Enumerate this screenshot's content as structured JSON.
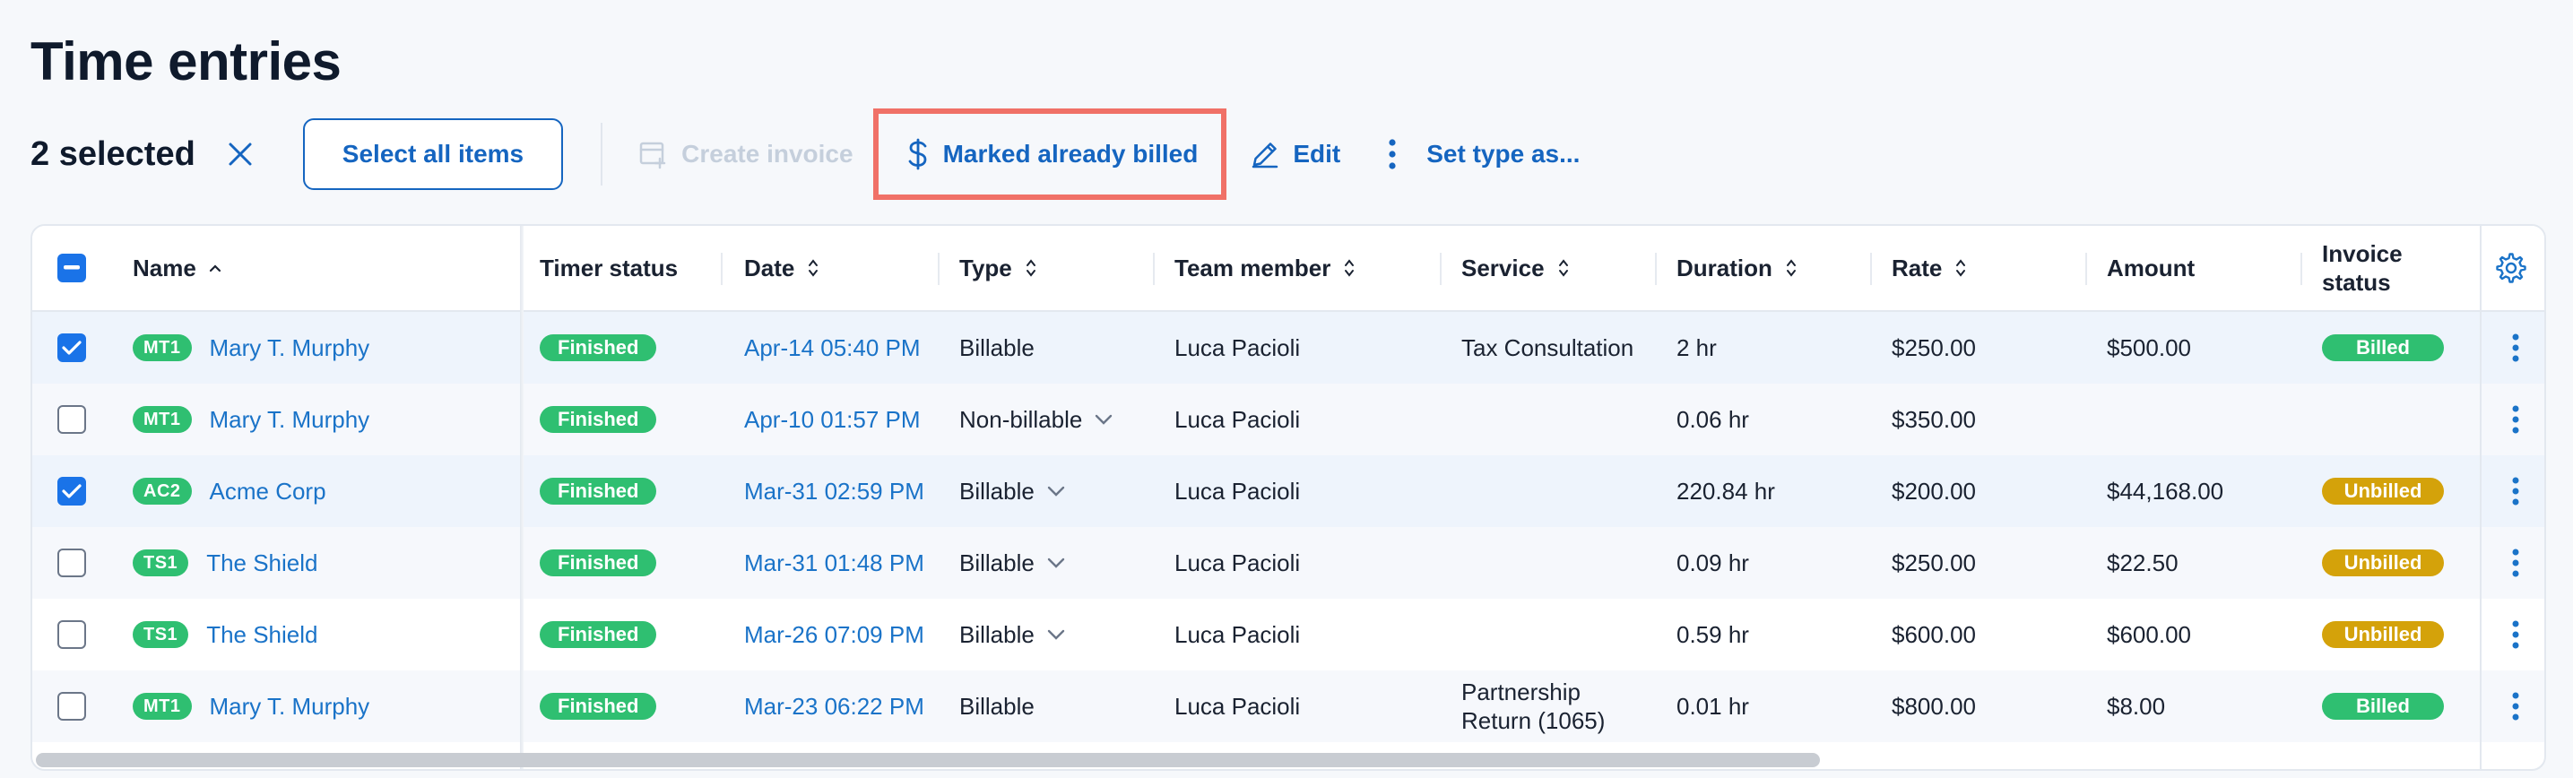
{
  "page": {
    "title": "Time entries"
  },
  "toolbar": {
    "selected_count": "2 selected",
    "select_all": "Select all items",
    "create_invoice": "Create invoice",
    "mark_billed": "Marked already billed",
    "edit": "Edit",
    "set_type": "Set type as..."
  },
  "table": {
    "headers": {
      "name": "Name",
      "timer_status": "Timer status",
      "date": "Date",
      "type": "Type",
      "team_member": "Team member",
      "service": "Service",
      "duration": "Duration",
      "rate": "Rate",
      "amount": "Amount",
      "invoice_status_1": "Invoice",
      "invoice_status_2": "status"
    },
    "rows": [
      {
        "checked": true,
        "badge": "MT1",
        "name": "Mary T. Murphy",
        "timer": "Finished",
        "date": "Apr-14 05:40 PM",
        "type": "Billable",
        "member": "Luca Pacioli",
        "service_1": "Tax Consultation",
        "service_2": "",
        "duration": "2 hr",
        "rate": "$250.00",
        "amount": "$500.00",
        "invoice": "Billed"
      },
      {
        "checked": false,
        "badge": "MT1",
        "name": "Mary T. Murphy",
        "timer": "Finished",
        "date": "Apr-10 01:57 PM",
        "type": "Non-billable",
        "member": "Luca Pacioli",
        "service_1": "",
        "service_2": "",
        "duration": "0.06 hr",
        "rate": "$350.00",
        "amount": "",
        "invoice": ""
      },
      {
        "checked": true,
        "badge": "AC2",
        "name": "Acme Corp",
        "timer": "Finished",
        "date": "Mar-31 02:59 PM",
        "type": "Billable",
        "member": "Luca Pacioli",
        "service_1": "",
        "service_2": "",
        "duration": "220.84 hr",
        "rate": "$200.00",
        "amount": "$44,168.00",
        "invoice": "Unbilled"
      },
      {
        "checked": false,
        "badge": "TS1",
        "name": "The Shield",
        "timer": "Finished",
        "date": "Mar-31 01:48 PM",
        "type": "Billable",
        "member": "Luca Pacioli",
        "service_1": "",
        "service_2": "",
        "duration": "0.09 hr",
        "rate": "$250.00",
        "amount": "$22.50",
        "invoice": "Unbilled"
      },
      {
        "checked": false,
        "badge": "TS1",
        "name": "The Shield",
        "timer": "Finished",
        "date": "Mar-26 07:09 PM",
        "type": "Billable",
        "member": "Luca Pacioli",
        "service_1": "",
        "service_2": "",
        "duration": "0.59 hr",
        "rate": "$600.00",
        "amount": "$600.00",
        "invoice": "Unbilled"
      },
      {
        "checked": false,
        "badge": "MT1",
        "name": "Mary T. Murphy",
        "timer": "Finished",
        "date": "Mar-23 06:22 PM",
        "type": "Billable",
        "member": "Luca Pacioli",
        "service_1": "Partnership",
        "service_2": "Return (1065)",
        "duration": "0.01 hr",
        "rate": "$800.00",
        "amount": "$8.00",
        "invoice": "Billed"
      }
    ]
  },
  "colors": {
    "accent": "#1565c0",
    "link": "#1a73c8",
    "finished_green": "#2fbf71",
    "billed_green": "#2fbf71",
    "unbilled_gold": "#d4a20a",
    "highlight_border": "#f07167"
  },
  "icons": {
    "clear": "close-icon",
    "create_invoice": "invoice-add-icon",
    "mark_billed": "dollar-icon",
    "edit": "pencil-icon",
    "set_type": "vertical-dots-icon",
    "settings": "gear-icon",
    "row_menu": "kebab-icon",
    "sort": "sort-arrows-icon"
  }
}
